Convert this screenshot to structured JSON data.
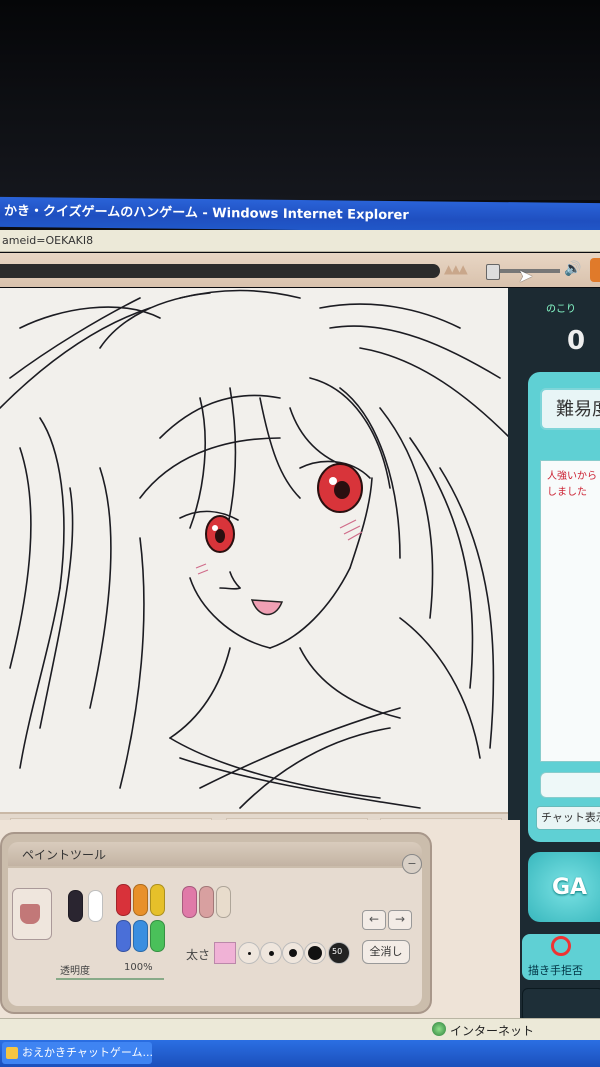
{
  "window": {
    "title": "かき・クイズゲームのハンゲーム - Windows Internet Explorer",
    "address_fragment": "ameid=OEKAKI8"
  },
  "game": {
    "nokori_label": "のこり",
    "nokori_value": "0"
  },
  "sidebar": {
    "difficulty_title": "難易度",
    "chat_lines": [
      "人強いから",
      "しました"
    ],
    "chat_button_label": "チャット表示",
    "ga_label": "GA",
    "refuse_label": "描き手拒否"
  },
  "paint_tool": {
    "title": "ペイントツール",
    "close_label": "−",
    "opacity_label": "透明度",
    "opacity_value": "100%",
    "size_label": "太さ",
    "size_max_label": "50",
    "undo_label": "←",
    "redo_label": "→",
    "clear_label": "全消し",
    "pen_colors": [
      "#2a2530",
      "#ffffff",
      "#d8323a",
      "#e8902a",
      "#e6c02a",
      "#e07aa8",
      "#d8a0a0",
      "#e8dccc",
      "#4a6fd8",
      "#3a8ee0",
      "#4ac05a"
    ]
  },
  "statusbar": {
    "zone_label": "インターネット"
  },
  "taskbar": {
    "item_label": "おえかきチャットゲーム..."
  }
}
